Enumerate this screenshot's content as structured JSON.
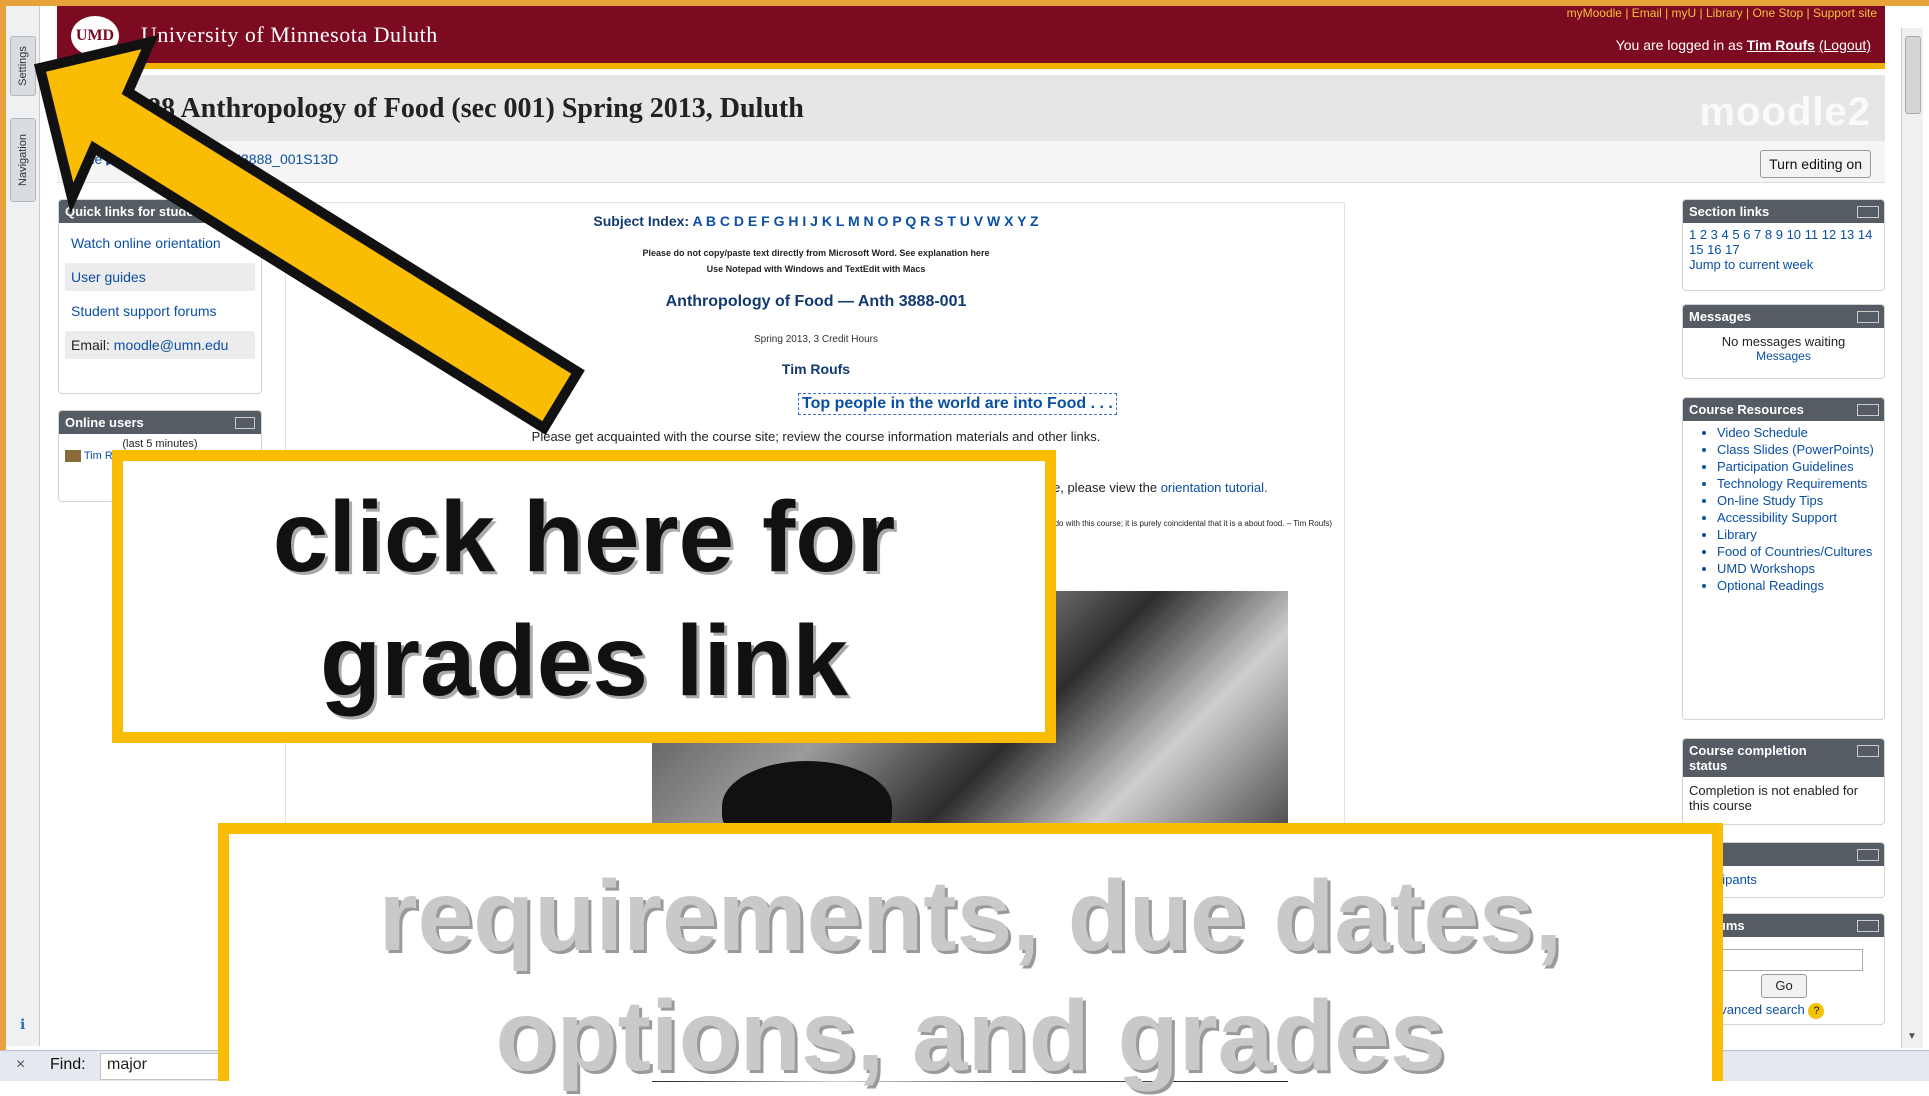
{
  "header": {
    "logo_text": "UMD",
    "university": "University of Minnesota Duluth",
    "top_links": "myMoodle | Email | myU | Library | One Stop | Support site",
    "logged_in_prefix": "You are logged in as",
    "user_name": "Tim Roufs",
    "logout": "(Logout)"
  },
  "dock": {
    "settings": "Settings",
    "navigation": "Navigation",
    "footer_icon": "ℹ"
  },
  "page": {
    "course_title": "3888 Anthropology of Food (sec 001) Spring 2013, Duluth",
    "brand": "moodle2",
    "breadcrumb_home": "Home",
    "breadcrumb_course": "H3888_001S13D",
    "turn_editing": "Turn editing on"
  },
  "quick_links": {
    "title": "Quick links for students",
    "items": [
      "Watch online orientation",
      "User guides",
      "Student support forums"
    ],
    "email_label": "Email:",
    "email": "moodle@umn.edu"
  },
  "online_users": {
    "title": "Online users",
    "subtitle": "(last 5 minutes)",
    "user": "Tim R"
  },
  "main": {
    "subject_index_label": "Subject Index:",
    "subject_index_letters": "A B C D E F G H I J K L M N O P Q R S T U V W X Y Z",
    "notice_1": "Please do not copy/paste text directly from Microsoft Word.  See explanation here",
    "notice_2": "Use Notepad with Windows and TextEdit with Macs",
    "course_heading": "Anthropology of Food — Anth 3888-001",
    "term": "Spring 2013, 3 Credit Hours",
    "instructor": "Tim Roufs",
    "top_people": "Top people in the world are into Food . . .",
    "acquaint": "Please get acquainted with the course site; review the course information materials and other links.",
    "orientation_prefix": "e, please view the",
    "orientation_link": "orientation tutorial.",
    "disclaimer": "g to do with this course; it is purely coincidental that it is a about food. – Tim Roufs)"
  },
  "right": {
    "section_links": {
      "title": "Section links",
      "numbers": "1 2 3 4 5 6 7 8 9 10 11 12 13 14 15 16 17",
      "jump": "Jump to current week"
    },
    "messages": {
      "title": "Messages",
      "body": "No messages waiting",
      "link": "Messages"
    },
    "course_resources": {
      "title": "Course Resources",
      "items": [
        "Video Schedule",
        "Class Slides (PowerPoints)",
        "Participation Guidelines",
        "Technology Requirements",
        "On-line Study Tips",
        "Accessibility Support",
        "Library",
        "Food of Countries/Cultures",
        "UMD Workshops",
        "Optional Readings"
      ]
    },
    "completion": {
      "title": "Course completion status",
      "body": "Completion is not enabled for this course"
    },
    "people": {
      "title": "e",
      "link": "Participants"
    },
    "search": {
      "title": "h forums",
      "go": "Go",
      "advanced": "dvanced search"
    }
  },
  "findbar": {
    "close": "×",
    "label": "Find:",
    "value": "major"
  },
  "overlays": {
    "callout_primary": "click here for grades link",
    "callout_secondary": "requirements, due dates, options, and grades",
    "arrow_color": "#fbbc04"
  }
}
